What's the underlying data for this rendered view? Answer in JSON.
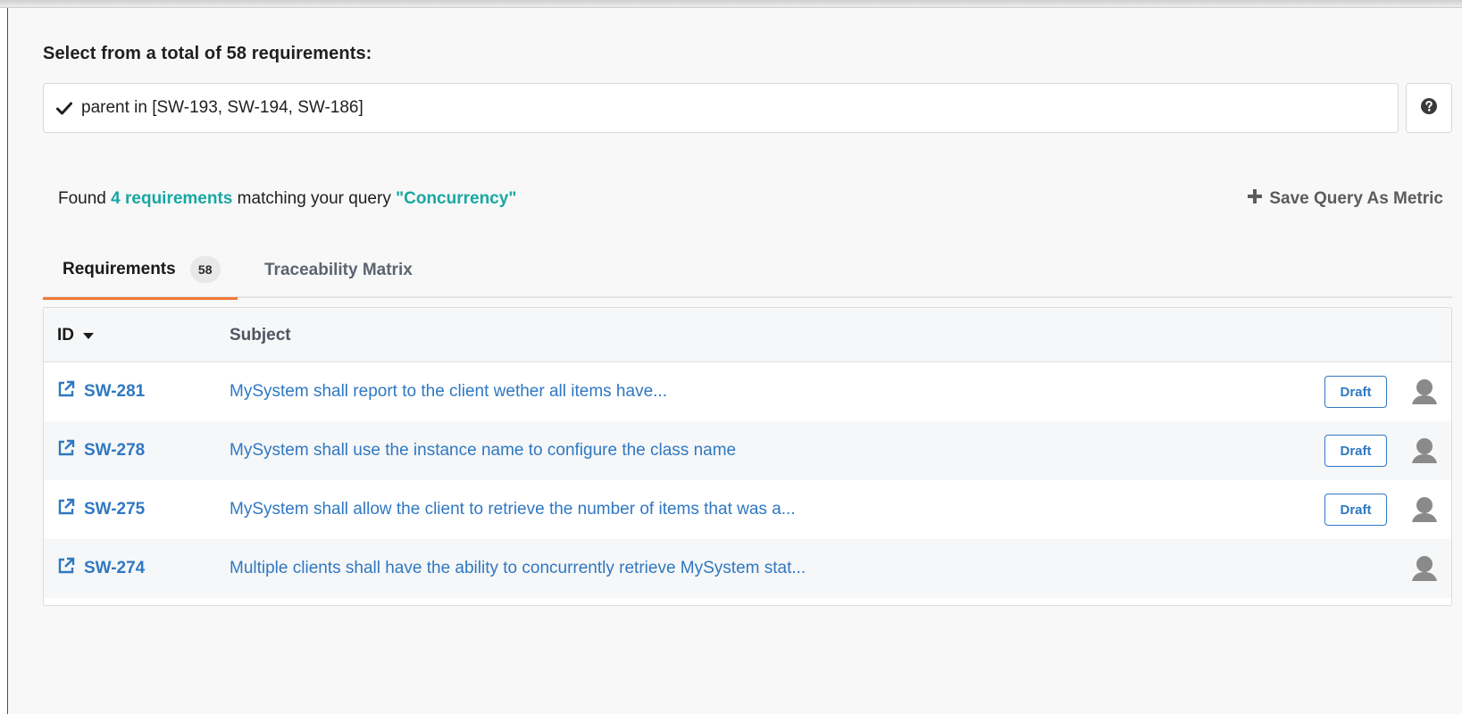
{
  "header": {
    "select_title": "Select from a total of 58 requirements:"
  },
  "query": {
    "value": "parent in [SW-193, SW-194, SW-186]"
  },
  "results": {
    "found_prefix": "Found",
    "found_count": "4 requirements",
    "found_middle": "matching your query",
    "found_query": "\"Concurrency\""
  },
  "actions": {
    "save_metric_label": "Save Query As Metric"
  },
  "tabs": [
    {
      "label": "Requirements",
      "badge": "58",
      "active": true
    },
    {
      "label": "Traceability Matrix",
      "active": false
    }
  ],
  "table": {
    "columns": {
      "id": "ID",
      "subject": "Subject"
    },
    "rows": [
      {
        "id": "SW-281",
        "subject": "MySystem shall report to the client wether all items have...",
        "status": "Draft"
      },
      {
        "id": "SW-278",
        "subject": "MySystem shall use the instance name to configure the class name",
        "status": "Draft"
      },
      {
        "id": "SW-275",
        "subject": "MySystem shall allow the client to retrieve the number of items that was a...",
        "status": "Draft"
      },
      {
        "id": "SW-274",
        "subject": "Multiple clients shall have the ability to concurrently retrieve MySystem stat...",
        "status": ""
      }
    ]
  },
  "colors": {
    "accent_teal": "#1aa7a3",
    "link_blue": "#2f78c2",
    "tab_active_underline": "#f07a36"
  },
  "icons": {
    "query_status": "check-icon",
    "help": "question-circle-icon",
    "save_metric": "plus-icon",
    "sort": "caret-down-icon",
    "row_open": "external-link-icon",
    "assignee": "user-avatar-icon"
  }
}
